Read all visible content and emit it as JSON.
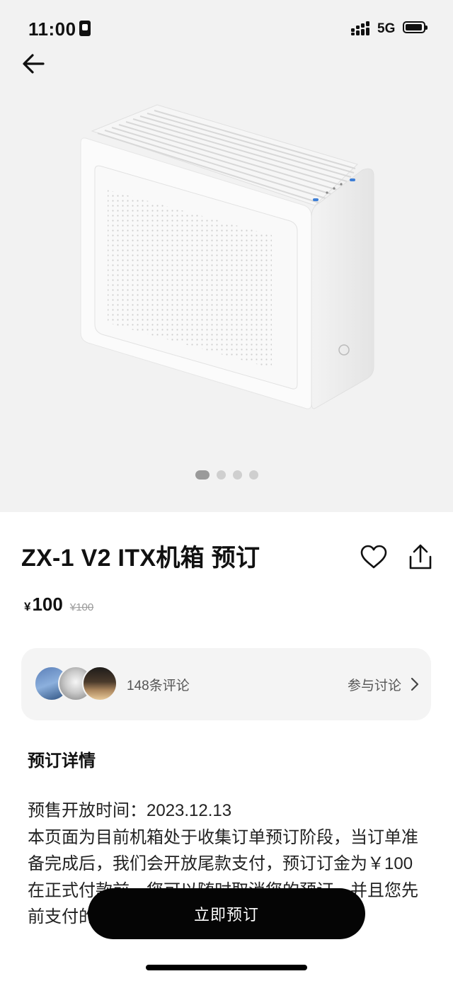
{
  "status_bar": {
    "time": "11:00",
    "network": "5G"
  },
  "gallery": {
    "image_count": 4,
    "active_index": 0
  },
  "product": {
    "title": "ZX-1 V2 ITX机箱 预订",
    "currency": "¥",
    "price": "100",
    "original_price": "¥100"
  },
  "reviews": {
    "count_text": "148条评论",
    "discuss_label": "参与讨论"
  },
  "details": {
    "heading": "预订详情",
    "lines": [
      "预售开放时间：2023.12.13",
      "本页面为目前机箱处于收集订单预订阶段，当订单准备完成后，我们会开放尾款支付，预订订金为￥100",
      "在正式付款前，您可以随时取消您的预订，并且您先前支付的预订订金将予以全额退还。"
    ]
  },
  "cta": {
    "label": "立即预订"
  },
  "colors": {
    "cta_bg": "#050505",
    "hero_bg": "#f2f2f2",
    "card_bg": "#f4f4f4"
  }
}
